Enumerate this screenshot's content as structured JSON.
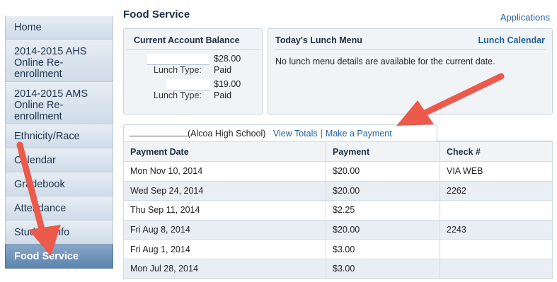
{
  "sidebar": {
    "items": [
      {
        "label": "Home"
      },
      {
        "label": "2014-2015 AHS Online Re-enrollment"
      },
      {
        "label": "2014-2015 AMS Online Re-enrollment"
      },
      {
        "label": "Ethnicity/Race"
      },
      {
        "label": "Calendar"
      },
      {
        "label": "Gradebook"
      },
      {
        "label": "Attendance"
      },
      {
        "label": "Student Info"
      },
      {
        "label": "Food Service"
      }
    ]
  },
  "header": {
    "title": "Food Service",
    "applications_link": "Applications"
  },
  "balance": {
    "title": "Current Account Balance",
    "lunch_type_label": "Lunch Type:",
    "accounts": [
      {
        "amount": "$28.00",
        "lunch_type": "Paid"
      },
      {
        "amount": "$19.00",
        "lunch_type": "Paid"
      }
    ]
  },
  "menu": {
    "title": "Today's Lunch Menu",
    "calendar_link": "Lunch Calendar",
    "message": "No lunch menu details are available for the current date."
  },
  "tab": {
    "school": "(Alcoa High School)",
    "view_totals": "View Totals",
    "separator": "|",
    "make_payment": "Make a Payment"
  },
  "table": {
    "headers": [
      "Payment Date",
      "Payment",
      "Check #"
    ],
    "rows": [
      [
        "Mon Nov 10, 2014",
        "$20.00",
        "VIA WEB"
      ],
      [
        "Wed Sep 24, 2014",
        "$20.00",
        "2262"
      ],
      [
        "Thu Sep 11, 2014",
        "$2.25",
        ""
      ],
      [
        "Fri Aug 8, 2014",
        "$20.00",
        "2243"
      ],
      [
        "Fri Aug 1, 2014",
        "$3.00",
        ""
      ],
      [
        "Mon Jul 28, 2014",
        "$3.00",
        ""
      ]
    ]
  },
  "colors": {
    "accent": "#1f5fa0",
    "active_nav": "#5d84ad",
    "annotation_arrow": "#ec5a4b"
  }
}
